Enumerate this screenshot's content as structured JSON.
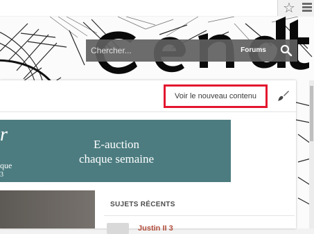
{
  "browser": {
    "bookmark_icon": "star-icon",
    "menu_icon": "hamburger-menu-icon"
  },
  "header": {
    "banner_text": "cent",
    "search": {
      "placeholder": "Chercher...",
      "scope_label": "Forums",
      "button_icon": "search-icon"
    }
  },
  "toolbar": {
    "new_content_label": "Voir le nouveau contenu",
    "theme_icon": "paintbrush-icon",
    "highlight_color": "#e3162f"
  },
  "promo": {
    "logo_text": "r",
    "line1": "E-auction",
    "line2": "chaque semaine",
    "left_text": "que",
    "left_number": "3",
    "background": "#4c7c80"
  },
  "sidebar": {
    "recent_title": "SUJETS RÉCENTS",
    "first_topic_user": "Justin II 3"
  }
}
